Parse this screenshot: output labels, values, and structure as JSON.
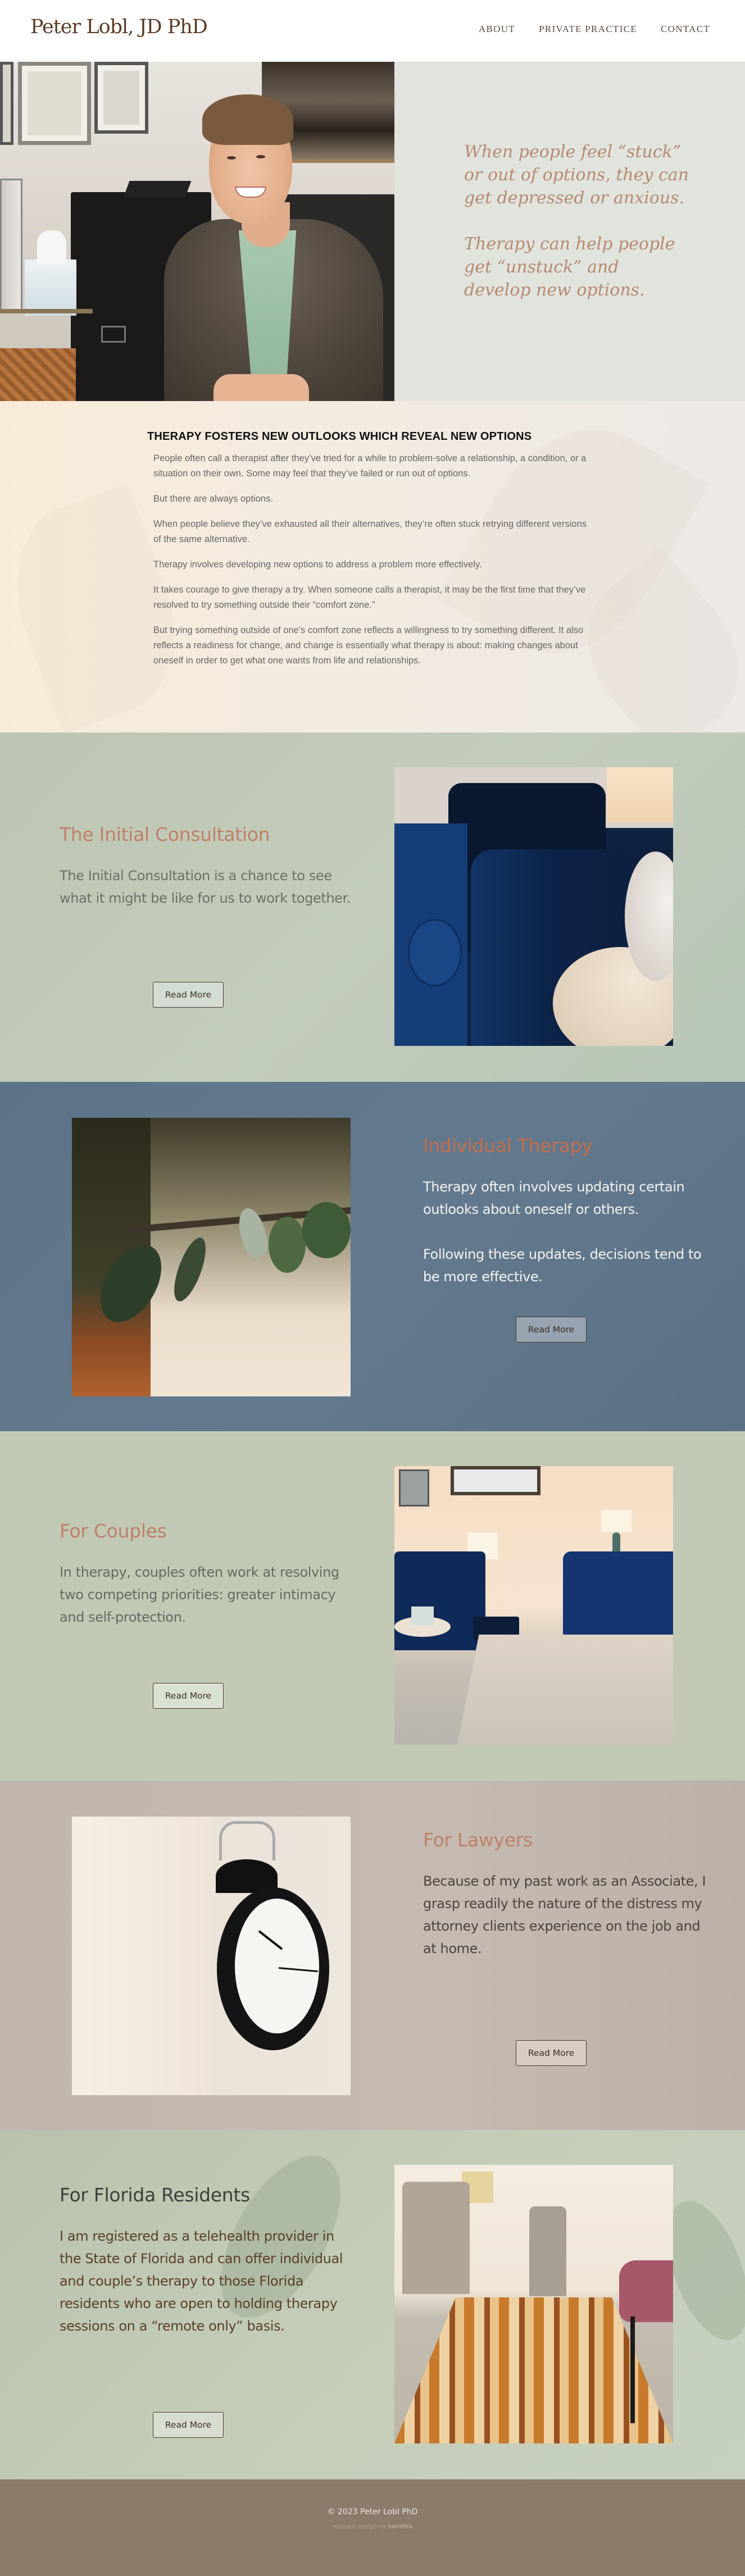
{
  "header": {
    "logo": "Peter Lobl, JD PhD",
    "nav": [
      "ABOUT",
      "PRIVATE PRACTICE",
      "CONTACT"
    ]
  },
  "hero": {
    "image_alt": "Portrait of Peter Lobl smiling in his office",
    "quote_lines": [
      "When people feel “stuck” or out of options, they can get depressed or anxious.",
      "Therapy can help people get “unstuck” and develop new options."
    ]
  },
  "intro": {
    "heading": "THERAPY FOSTERS NEW OUTLOOKS WHICH REVEAL NEW OPTIONS",
    "paragraphs": [
      "People often call a therapist after they’ve tried for a while to problem-solve a relationship, a condition, or a situation on their own. Some may feel that they’ve failed or run out of options.",
      "But there are always options.",
      "When people believe they’ve exhausted all their alternatives, they’re often stuck retrying different versions of the same alternative.",
      "Therapy involves developing new options to address a problem more effectively.",
      "It takes courage to give therapy a try. When someone calls a therapist, it may be the first time that they’ve resolved to try something outside their ”comfort zone.”",
      "But trying something outside of one’s comfort zone reflects a willingness to try something different. It also reflects a readiness for change, and change is essentially what therapy is about: making changes about oneself in order to get what one wants from life and relationships."
    ]
  },
  "sections": [
    {
      "title": "The Initial Consultation",
      "paragraphs": [
        "The Initial Consultation is a chance to see what it might be like for us to work together."
      ],
      "button": "Read More",
      "image_alt": "Blue velvet armchair beside a round marble side table with lamp",
      "title_color": "#c07f6a",
      "text_color": "#6b6f68"
    },
    {
      "title": "Individual Therapy",
      "paragraphs": [
        "Therapy often involves updating certain outlooks about oneself or others.",
        "Following these updates, decisions tend to be more effective."
      ],
      "button": "Read More",
      "image_alt": "Close-up of green plant leaves in a terracotta pot",
      "title_color": "#c26f4c",
      "text_color": "#f3f3f0"
    },
    {
      "title": "For Couples",
      "paragraphs": [
        "In therapy, couples often work at resolving two competing priorities: greater intimacy and self-protection."
      ],
      "button": "Read More",
      "image_alt": "Therapy room with blue velvet sofa, armchair, lamps and rug",
      "title_color": "#bf7f68",
      "text_color": "#646a61"
    },
    {
      "title": "For Lawyers",
      "paragraphs": [
        "Because of my past work as an Associate, I grasp readily the nature of the distress my attorney clients experience on the job and at home."
      ],
      "button": "Read More",
      "image_alt": "Black alarm clock on a white table",
      "title_color": "#bf8069",
      "text_color": "#4a4340"
    },
    {
      "title": "For Florida Residents",
      "paragraphs": [
        "I am registered as a telehealth provider in the State of Florida and can offer individual and couple’s therapy to those Florida residents who are open to holding therapy sessions on a “remote only” basis."
      ],
      "button": "Read More",
      "image_alt": "Waiting room with chairs and patterned orange rug",
      "title_color": "#3f3f3a",
      "text_color": "#5a3e2a"
    }
  ],
  "footer": {
    "copyright": "© 2023 Peter Lobl PhD",
    "credit_prefix": "website design by ",
    "credit_name": "hamiltro"
  }
}
